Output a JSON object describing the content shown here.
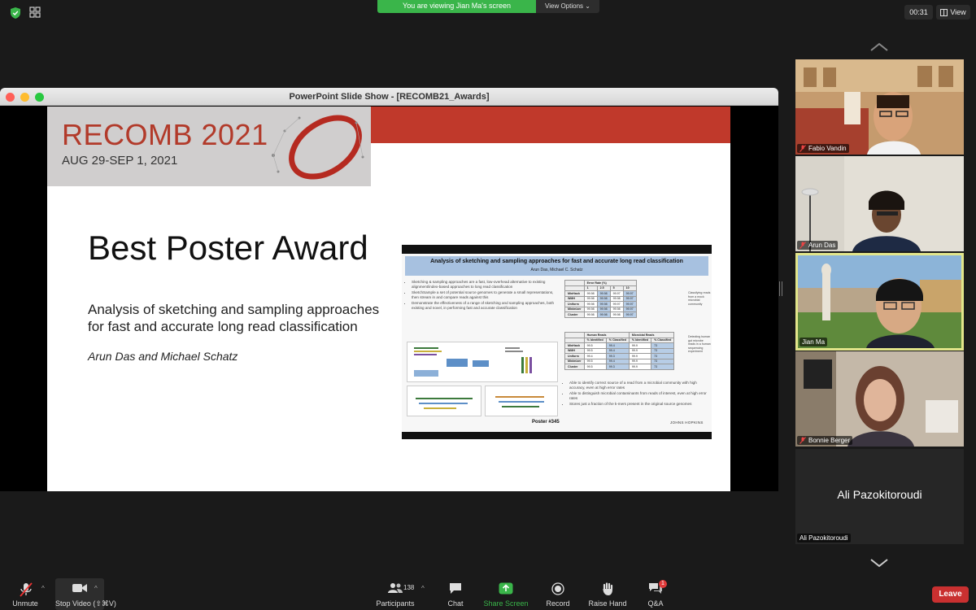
{
  "top": {
    "banner": "You are viewing Jian Ma's screen",
    "view_options": "View Options",
    "timer": "00:31",
    "view": "View"
  },
  "window": {
    "title": "PowerPoint Slide Show - [RECOMB21_Awards]"
  },
  "slide": {
    "conference": "RECOMB 2021",
    "dates": "AUG 29-SEP 1, 2021",
    "award": "Best Poster Award",
    "poster_title_line1": "Analysis of sketching and sampling approaches",
    "poster_title_line2": "for fast and accurate long read classification",
    "authors": "Arun Das and Michael Schatz",
    "poster": {
      "title": "Analysis of sketching and sampling approaches for fast and accurate long read classification",
      "authors": "Arun Das, Michael C. Schatz",
      "bullets_left": [
        "Sketching & sampling approaches are a fast, low-overhead alternative to existing alignment/index-based approaches to long read classification",
        "SketchSample a set of potential source genomes to generate a small representations, then stream in and compare reads against this",
        "Demonstrate the effectiveness of a range of sketching and sampling approaches, both existing and novel, in performing fast and accurate classification"
      ],
      "bullets_right": [
        "Able to identify correct source of a read from a microbial community with high accuracy, even at high error rates",
        "Able to distinguish microbial contaminants from reads of interest, even at high error rates",
        "Stores just a fraction of the k-mers present in the original source genomes"
      ],
      "table1_header": "Error Rate (%)",
      "table1_cols": [
        "1",
        "2.5",
        "5",
        "10"
      ],
      "table1_rows": [
        [
          "MinHash",
          "99.98",
          "99.98",
          "99.97",
          "99.97"
        ],
        [
          "WMH",
          "99.98",
          "99.98",
          "99.98",
          "99.97"
        ],
        [
          "Uniform",
          "99.98",
          "99.98",
          "99.97",
          "99.97"
        ],
        [
          "Minimizer",
          "99.98",
          "99.98",
          "99.98",
          "99.97"
        ],
        [
          "Cluster",
          "99.98",
          "99.98",
          "99.98",
          "99.97"
        ]
      ],
      "table1_note": "Classifying reads from a mock microbial community",
      "table2_groups": [
        "Human Reads",
        "Microbial Reads"
      ],
      "table2_cols": [
        "% Identified",
        "% Classified",
        "% Identified",
        "% Classified"
      ],
      "table2_rows": [
        [
          "MinHash",
          "99.5",
          "99.4",
          "99.9",
          "73"
        ],
        [
          "WMH",
          "99.5",
          "99.4",
          "99.9",
          "73"
        ],
        [
          "Uniform",
          "99.4",
          "99.3",
          "99.9",
          "73"
        ],
        [
          "Minimizer",
          "99.5",
          "99.4",
          "99.9",
          "73"
        ],
        [
          "Cluster",
          "99.5",
          "99.3",
          "99.9",
          "73"
        ]
      ],
      "table2_note": "Detecting human gut microbe reads in a human sequencing experiment",
      "number": "Poster #345",
      "institution": "JOHNS HOPKINS"
    }
  },
  "participants": [
    {
      "name": "Fabio Vandin",
      "muted": true
    },
    {
      "name": "Arun Das",
      "muted": true
    },
    {
      "name": "Jian Ma",
      "muted": false
    },
    {
      "name": "Bonnie Berger",
      "muted": true
    },
    {
      "name": "Ali Pazokitoroudi",
      "muted": false
    }
  ],
  "toolbar": {
    "unmute": "Unmute",
    "stop_video": "Stop Video (⇧⌘V)",
    "participants": "Participants",
    "participants_count": "138",
    "chat": "Chat",
    "share_screen": "Share Screen",
    "record": "Record",
    "raise_hand": "Raise Hand",
    "qa": "Q&A",
    "qa_badge": "1",
    "leave": "Leave"
  },
  "colors": {
    "share_green": "#3ab54a",
    "leave_red": "#c93030",
    "active_speaker": "#e2e58a",
    "recomb_red": "#c0392b"
  }
}
